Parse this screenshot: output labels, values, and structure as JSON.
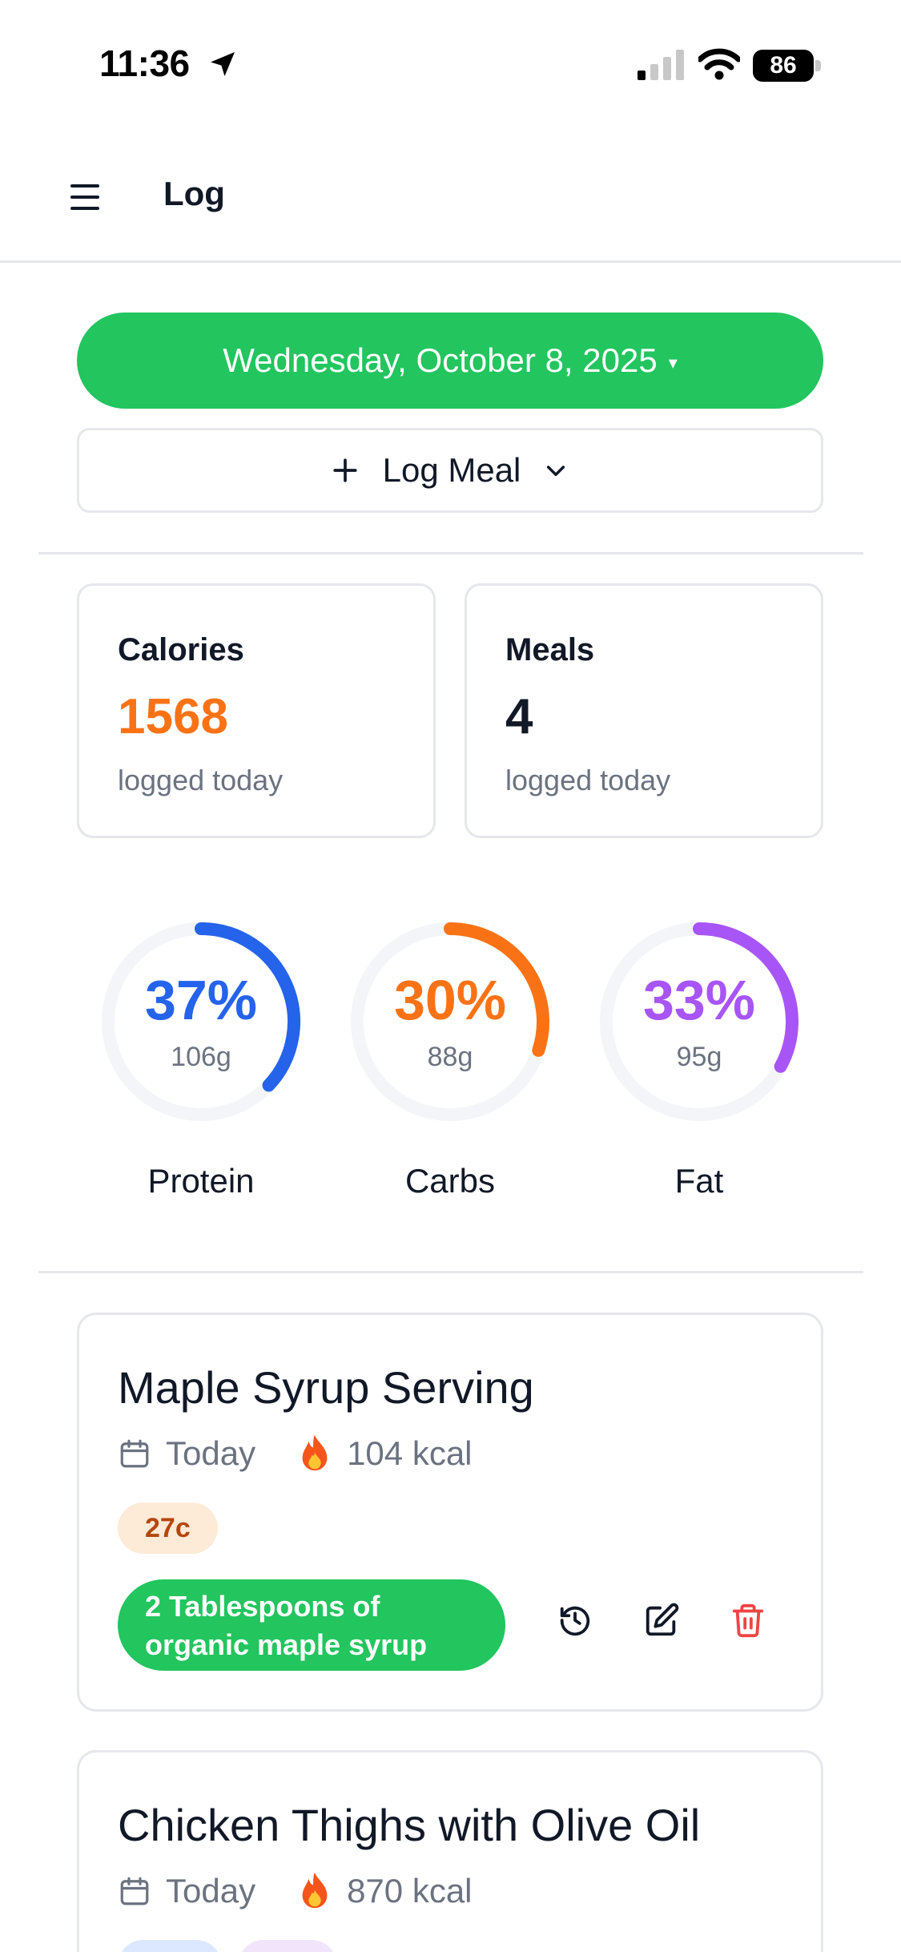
{
  "status_bar": {
    "time": "11:36",
    "battery": "86"
  },
  "header": {
    "title": "Log"
  },
  "date_selector": {
    "label": "Wednesday, October 8, 2025",
    "caret": "▾"
  },
  "log_meal": {
    "label": "Log Meal"
  },
  "stats": {
    "calories": {
      "title": "Calories",
      "value": "1568",
      "subtitle": "logged today",
      "color": "#f97316"
    },
    "meals": {
      "title": "Meals",
      "value": "4",
      "subtitle": "logged today",
      "color": "#111827"
    }
  },
  "macros": [
    {
      "label": "Protein",
      "percent_text": "37%",
      "grams": "106g",
      "percent": 37,
      "color": "#2563eb"
    },
    {
      "label": "Carbs",
      "percent_text": "30%",
      "grams": "88g",
      "percent": 30,
      "color": "#f97316"
    },
    {
      "label": "Fat",
      "percent_text": "33%",
      "grams": "95g",
      "percent": 33,
      "color": "#a855f7"
    }
  ],
  "meals": [
    {
      "title": "Maple Syrup Serving",
      "date": "Today",
      "kcal": "104 kcal",
      "badges": [
        {
          "text": "27c",
          "type": "carbs"
        }
      ],
      "description": "2 Tablespoons of organic maple syrup"
    },
    {
      "title": "Chicken Thighs with Olive Oil",
      "date": "Today",
      "kcal": "870 kcal",
      "badges": [
        {
          "text": "",
          "type": "protein"
        },
        {
          "text": "",
          "type": "fat"
        }
      ]
    }
  ],
  "icons": {
    "menu": "menu-icon",
    "calendar": "calendar-icon",
    "fire": "fire-icon",
    "history": "history-icon",
    "edit": "edit-icon",
    "delete": "trash-icon"
  }
}
